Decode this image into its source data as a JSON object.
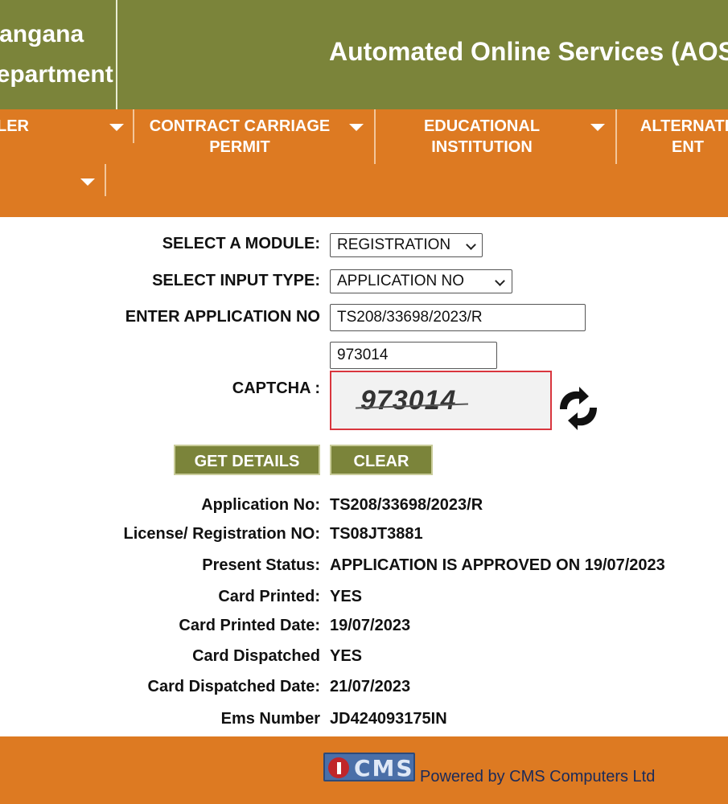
{
  "header": {
    "dept_line1": "Telangana",
    "dept_line2": "Department",
    "title": "Automated Online Services (AOS)"
  },
  "nav": {
    "items": [
      {
        "label": "LER"
      },
      {
        "label_line1": "CONTRACT CARRIAGE",
        "label_line2": "PERMIT"
      },
      {
        "label_line1": "EDUCATIONAL",
        "label_line2": "INSTITUTION"
      },
      {
        "label_line1": "ALTERNATE",
        "label_line2": "ENT"
      }
    ]
  },
  "form": {
    "module_label": "SELECT A MODULE:",
    "module_value": "REGISTRATION",
    "input_type_label": "SELECT INPUT TYPE:",
    "input_type_value": "APPLICATION NO",
    "app_no_label": "ENTER APPLICATION NO",
    "app_no_value": "TS208/33698/2023/R",
    "captcha_input_value": "973014",
    "captcha_label": "CAPTCHA :",
    "captcha_image_text": "973014",
    "get_details_label": "GET DETAILS",
    "clear_label": "CLEAR"
  },
  "results": [
    {
      "label": "Application No:",
      "value": "TS208/33698/2023/R"
    },
    {
      "label": "License/ Registration NO:",
      "value": "TS08JT3881"
    },
    {
      "label": "Present Status:",
      "value": "APPLICATION IS APPROVED ON 19/07/2023"
    },
    {
      "label": "Card Printed:",
      "value": "YES"
    },
    {
      "label": "Card Printed Date:",
      "value": "19/07/2023"
    },
    {
      "label": "Card Dispatched",
      "value": "YES"
    },
    {
      "label": "Card Dispatched Date:",
      "value": "21/07/2023"
    },
    {
      "label": "Ems Number",
      "value": "JD424093175IN"
    }
  ],
  "footer": {
    "logo_text": "CMS",
    "powered_by": "Powered by CMS Computers Ltd"
  },
  "colors": {
    "header_olive": "#7b843a",
    "nav_orange": "#dd7a22",
    "captcha_border": "#d9363e"
  }
}
